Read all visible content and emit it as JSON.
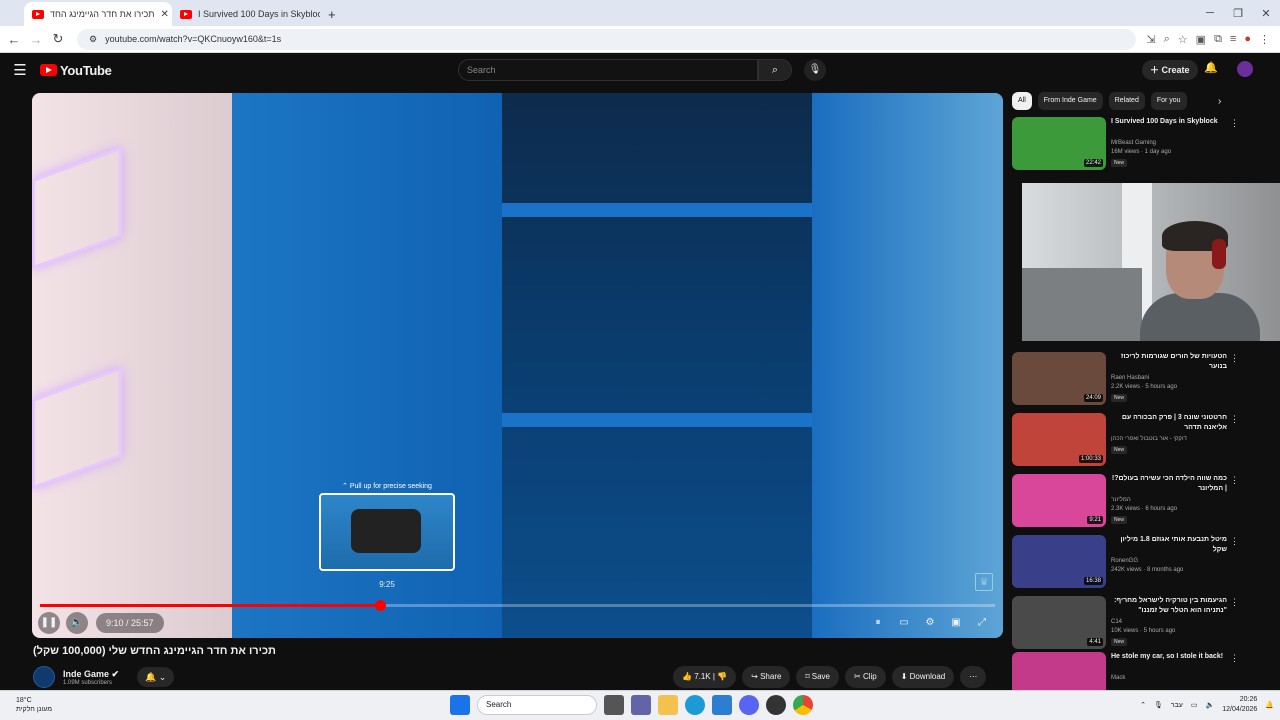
{
  "browser": {
    "tabs": [
      {
        "title": "תכירו את חדר הגיימינג החד",
        "active": true
      },
      {
        "title": "I Survived 100 Days in Skybloc",
        "active": false
      }
    ],
    "new_tab": "+",
    "url": "youtube.com/watch?v=QKCnuoyw160&t=1s"
  },
  "header": {
    "logo": "YouTube",
    "search_placeholder": "Search",
    "create_label": "Create"
  },
  "player": {
    "preview_hint": "Pull up for precise seeking",
    "preview_time": "9:25",
    "progress_fraction": 0.356,
    "time_display": "9:10 / 25:57"
  },
  "video": {
    "title": "תכירו את חדר הגיימינג החדש שלי (100,000 שקל)",
    "channel": "Inde Game",
    "subscribers": "1.09M subscribers",
    "likes": "7.1K",
    "share": "Share",
    "save": "Save",
    "clip": "Clip",
    "download": "Download"
  },
  "chips": [
    "All",
    "From Inde Game",
    "Related",
    "For you"
  ],
  "related": [
    {
      "title": "I Survived 100 Days in Skyblock",
      "channel": "MrBeast Gaming",
      "meta": "16M views · 1 day ago",
      "badge": "New",
      "duration": "22:42",
      "color": "#3c9a3a"
    },
    {
      "title": "הטעויות של הורים שגורמות לריכוז בנוער",
      "channel": "Raen Hasbani",
      "meta": "2.2K views · 5 hours ago",
      "badge": "New",
      "duration": "24:09",
      "color": "#6a4a3c"
    },
    {
      "title": "חרטטוני שונה 3 | פרק הבכורה עם אליאנה תדהר",
      "channel": "דוקקי - אור בוטבול ואפרי הכהן",
      "meta": "",
      "badge": "New",
      "duration": "1:00:33",
      "color": "#c0443a"
    },
    {
      "title": "כמה שווה הילדה הכי עשירה בעולם?! | המליונר",
      "channel": "המליונר",
      "meta": "2.3K views · 6 hours ago",
      "badge": "New",
      "duration": "9:21",
      "color": "#d8479a"
    },
    {
      "title": "מיטל תנבעת אותי אגוזם 1.8 מיליון שקל",
      "channel": "RonenGG",
      "meta": "242K views · 8 months ago",
      "badge": "",
      "duration": "16:38",
      "color": "#3a3f8a"
    },
    {
      "title": "הגיעמות בין טורקיה לישראל מחריף: \"נתניהו הוא הטלר של זמננו\"",
      "channel": "C14",
      "meta": "10K views · 5 hours ago",
      "badge": "New",
      "duration": "4:41",
      "color": "#4a4a4a"
    },
    {
      "title": "He stole my car, so I stole it back!",
      "channel": "Mack",
      "meta": "",
      "badge": "",
      "duration": "",
      "color": "#c43a8a"
    }
  ],
  "taskbar": {
    "temp": "18°C",
    "weather_desc": "מעונן חלקית",
    "search": "Search",
    "lang": "עבר",
    "time": "20:26",
    "date": "12/04/2026"
  }
}
